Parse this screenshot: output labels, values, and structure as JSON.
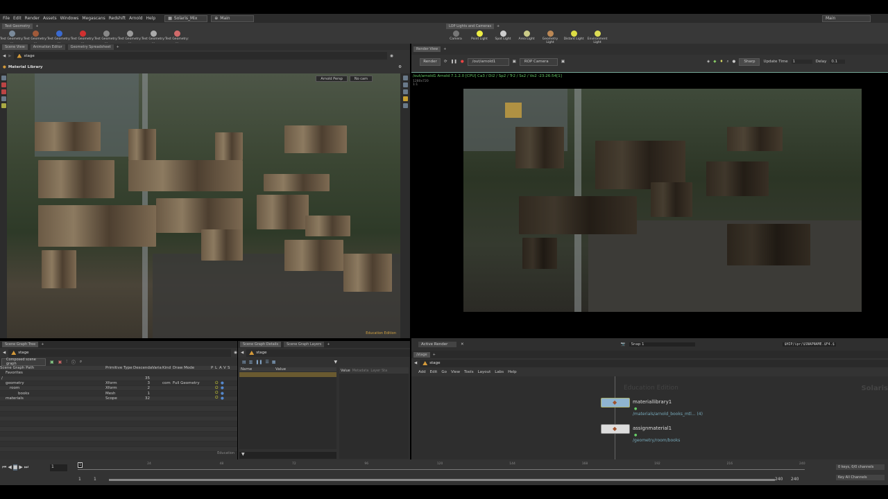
{
  "menubar": {
    "items": [
      "File",
      "Edit",
      "Render",
      "Assets",
      "Windows",
      "Megascans",
      "Redshift",
      "Arnold",
      "Help"
    ],
    "desktop": "Solaris_Mix",
    "context": "Main",
    "right_context": "Main"
  },
  "shelf_left": {
    "tab": "Test Geometry",
    "tools": [
      "Test Geometry: ...",
      "Test Geometry: ...",
      "Test Geometry: ...",
      "Test Geometry: ...",
      "Test Geometry: ...",
      "Test Geometry: ...",
      "Test Geometry: ...",
      "Test Geometry: ..."
    ]
  },
  "shelf_right": {
    "tab": "LOP Lights and Cameras",
    "tools": [
      "Camera",
      "Point Light",
      "Spot Light",
      "Area Light",
      "Geometry Light",
      "Distant Light",
      "Environment Light"
    ]
  },
  "left_pane": {
    "tabs": [
      "Scene View",
      "Animation Editor",
      "Geometry Spreadsheet"
    ],
    "path": "stage",
    "header": "Material Library",
    "renderer": "Arnold Persp",
    "camera": "No cam",
    "watermark": "Education Edition"
  },
  "render_view": {
    "tab": "Render View",
    "render_btn": "Render",
    "rop": "/out/arnold1",
    "camera": "ROP Camera",
    "mode": "Sharp",
    "update_time_label": "Update Time",
    "update_time": "1",
    "delay_label": "Delay",
    "delay": "0.1",
    "status": "/out/arnold1  Arnold 7.1.2.0 [CPU]  Ca3 / Di2 / Sp2 / Tr2 / Ss2 / Vo2 -23:26:54[1]",
    "resolution": "1280x720",
    "ratio": "1:1",
    "active_render": "Active Render",
    "snap": "Snap 1",
    "output_path": "$HIP/ipr/$SNAPNAME.$F4.$"
  },
  "scene_graph": {
    "tab": "Scene Graph Tree",
    "path": "stage",
    "mode": "Composed scene graph",
    "columns": [
      "Scene Graph Path",
      "Primitive Type",
      "Descenda",
      "Varia",
      "Kind",
      "Draw Mode",
      "P",
      "L",
      "A",
      "V",
      "S"
    ],
    "rows": [
      {
        "path": "Favorites",
        "type": "",
        "desc": "",
        "kind": "",
        "draw": ""
      },
      {
        "path": "/",
        "type": "",
        "desc": "35",
        "kind": "",
        "draw": ""
      },
      {
        "path": "geometry",
        "type": "Xform",
        "desc": "3",
        "kind": "com",
        "draw": "Full Geometry"
      },
      {
        "path": "room",
        "type": "Xform",
        "desc": "2",
        "kind": "",
        "draw": ""
      },
      {
        "path": "books",
        "type": "Mesh",
        "desc": "1",
        "kind": "",
        "draw": ""
      },
      {
        "path": "materials",
        "type": "Scope",
        "desc": "32",
        "kind": "",
        "draw": ""
      }
    ],
    "footer": "Education"
  },
  "details": {
    "tabs": [
      "Scene Graph Details",
      "Scene Graph Layers"
    ],
    "path": "stage",
    "columns": [
      "Name",
      "Value"
    ],
    "side_tabs": [
      "Value",
      "Metadata",
      "Layer Sta"
    ]
  },
  "network": {
    "tab": "/stage",
    "path": "stage",
    "menu": [
      "Add",
      "Edit",
      "Go",
      "View",
      "Tools",
      "Layout",
      "Labs",
      "Help"
    ],
    "watermark": "Education Edition",
    "context_label": "Solaris",
    "nodes": [
      {
        "name": "materiallibrary1",
        "info": "/materials/arnold_books_mtl... (4)"
      },
      {
        "name": "assignmaterial1",
        "info": "/geometry/room/books"
      }
    ]
  },
  "timeline": {
    "ticks": [
      "24",
      "48",
      "72",
      "96",
      "120",
      "144",
      "168",
      "192",
      "216",
      "240"
    ],
    "current_frame": "1",
    "start": "1",
    "start2": "1",
    "end": "240",
    "end2": "240",
    "keys_label": "0 keys, 0/0 channels",
    "key_all": "Key All Channels"
  }
}
